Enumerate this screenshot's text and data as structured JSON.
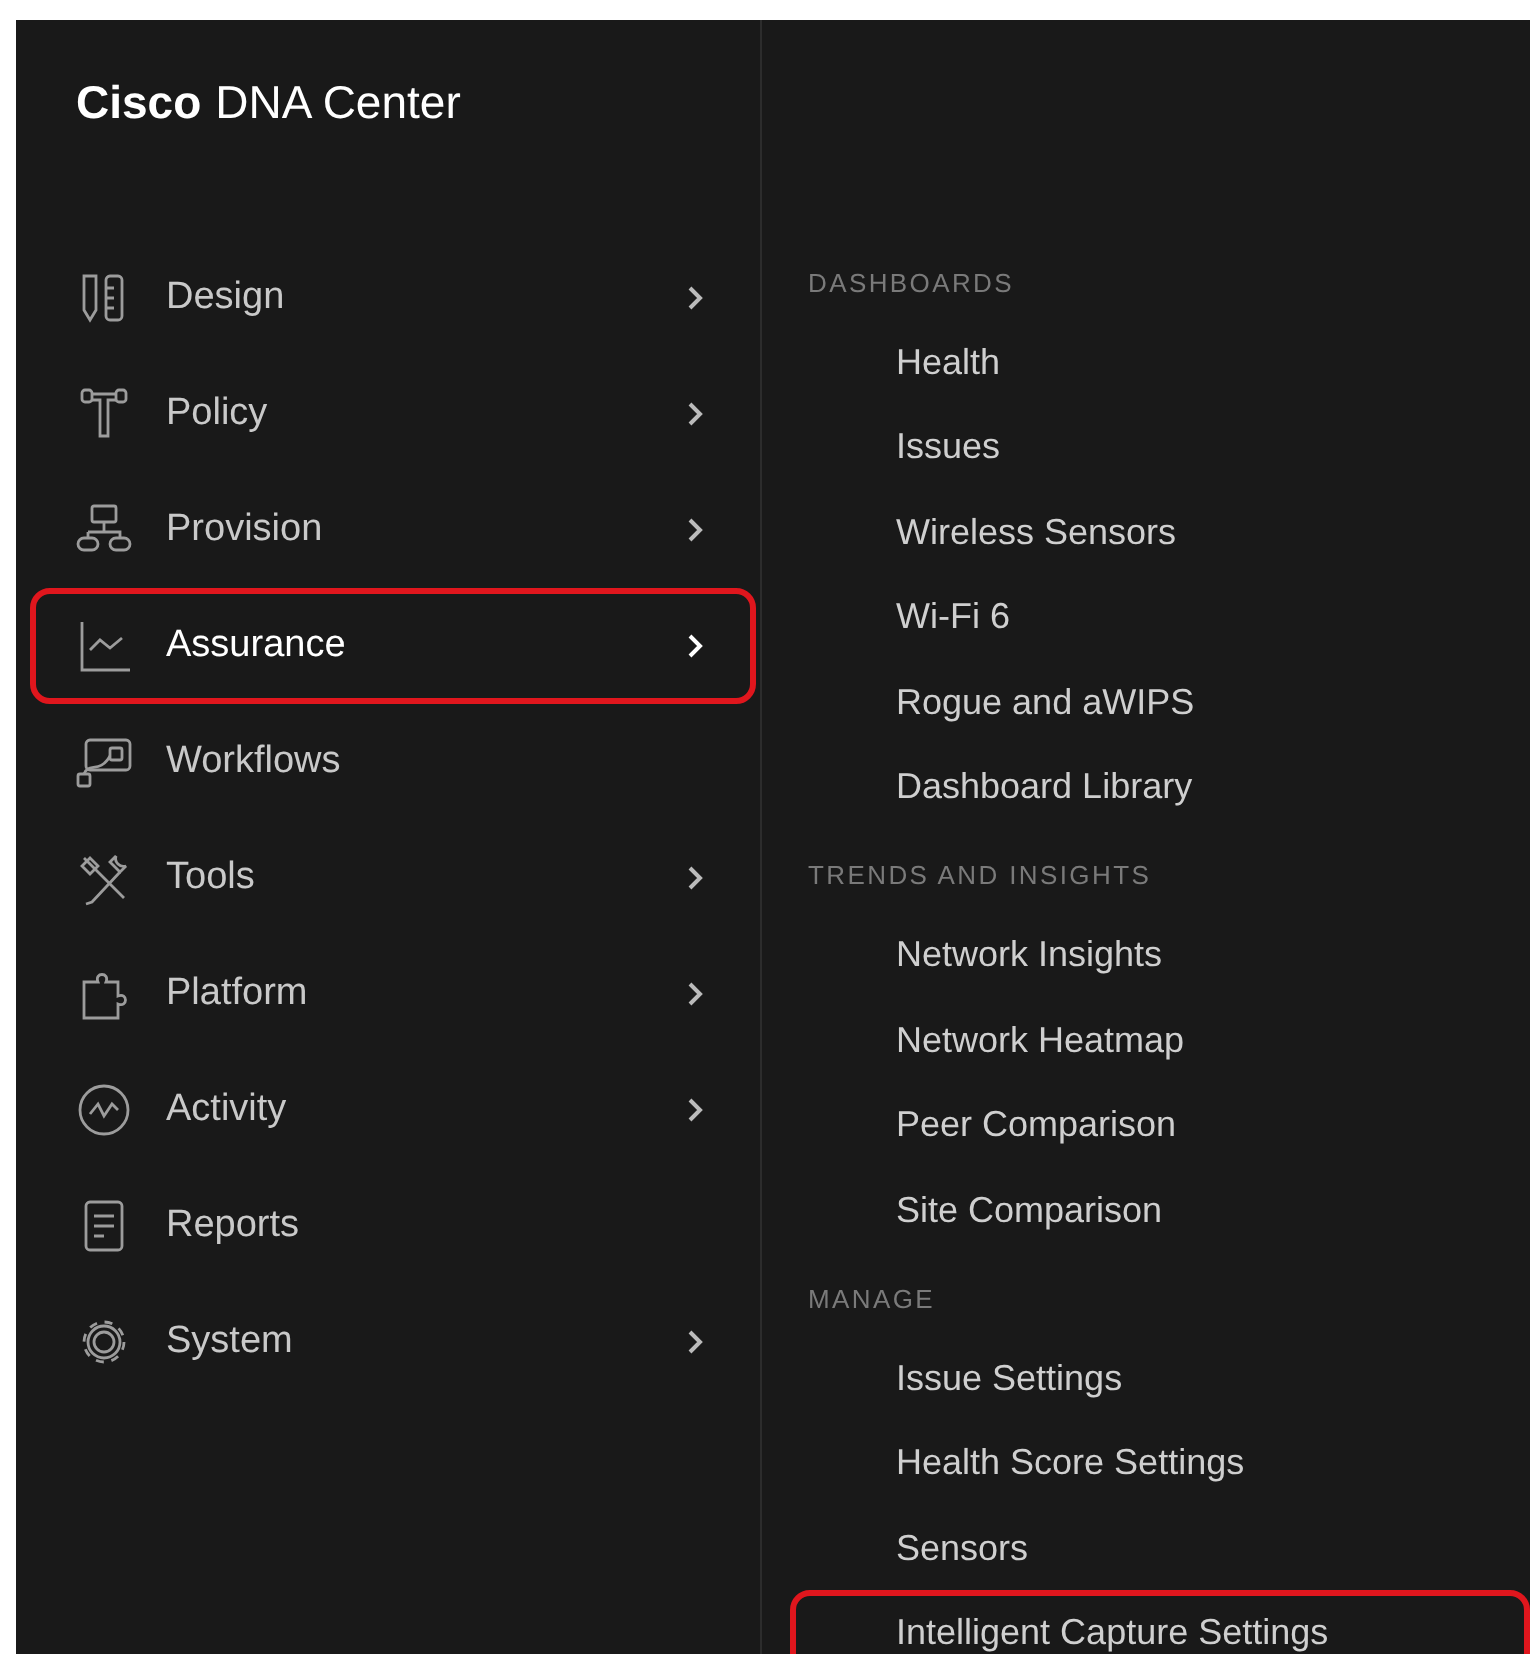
{
  "header": {
    "brand": "Cisco",
    "product": "DNA Center"
  },
  "nav": [
    {
      "label": "Design",
      "has_submenu": true,
      "selected": false,
      "highlighted": false
    },
    {
      "label": "Policy",
      "has_submenu": true,
      "selected": false,
      "highlighted": false
    },
    {
      "label": "Provision",
      "has_submenu": true,
      "selected": false,
      "highlighted": false
    },
    {
      "label": "Assurance",
      "has_submenu": true,
      "selected": true,
      "highlighted": true
    },
    {
      "label": "Workflows",
      "has_submenu": false,
      "selected": false,
      "highlighted": false
    },
    {
      "label": "Tools",
      "has_submenu": true,
      "selected": false,
      "highlighted": false
    },
    {
      "label": "Platform",
      "has_submenu": true,
      "selected": false,
      "highlighted": false
    },
    {
      "label": "Activity",
      "has_submenu": true,
      "selected": false,
      "highlighted": false
    },
    {
      "label": "Reports",
      "has_submenu": false,
      "selected": false,
      "highlighted": false
    },
    {
      "label": "System",
      "has_submenu": true,
      "selected": false,
      "highlighted": false
    }
  ],
  "submenu": {
    "sections": [
      {
        "heading": "DASHBOARDS",
        "items": [
          {
            "label": "Health",
            "highlighted": false
          },
          {
            "label": "Issues",
            "highlighted": false
          },
          {
            "label": "Wireless Sensors",
            "highlighted": false
          },
          {
            "label": "Wi-Fi 6",
            "highlighted": false
          },
          {
            "label": "Rogue and aWIPS",
            "highlighted": false
          },
          {
            "label": "Dashboard Library",
            "highlighted": false
          }
        ]
      },
      {
        "heading": "TRENDS AND INSIGHTS",
        "items": [
          {
            "label": "Network Insights",
            "highlighted": false
          },
          {
            "label": "Network Heatmap",
            "highlighted": false
          },
          {
            "label": "Peer Comparison",
            "highlighted": false
          },
          {
            "label": "Site Comparison",
            "highlighted": false
          }
        ]
      },
      {
        "heading": "MANAGE",
        "items": [
          {
            "label": "Issue Settings",
            "highlighted": false
          },
          {
            "label": "Health Score Settings",
            "highlighted": false
          },
          {
            "label": "Sensors",
            "highlighted": false
          },
          {
            "label": "Intelligent Capture Settings",
            "highlighted": true
          }
        ]
      }
    ]
  }
}
